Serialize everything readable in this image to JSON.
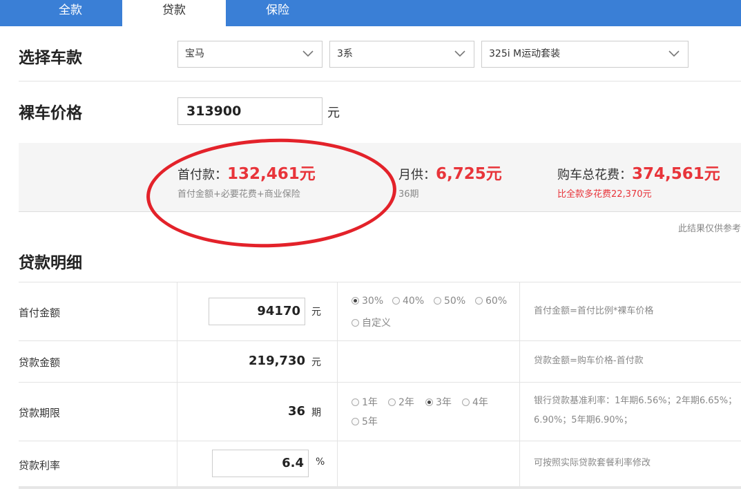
{
  "tabs": [
    {
      "label": "全款",
      "active": false
    },
    {
      "label": "贷款",
      "active": true
    },
    {
      "label": "保险",
      "active": false
    }
  ],
  "car_select": {
    "label": "选择车款",
    "brand": "宝马",
    "series": "3系",
    "model": "325i M运动套装"
  },
  "price": {
    "label": "裸车价格",
    "value": "313900",
    "unit": "元"
  },
  "summary": {
    "down_payment_label": "首付款：",
    "down_payment_value": "132,461元",
    "down_payment_note": "首付金额+必要花费+商业保险",
    "monthly_label": "月供：",
    "monthly_value": "6,725元",
    "monthly_note": "36期",
    "total_label": "购车总花费：",
    "total_value": "374,561元",
    "total_note": "比全款多花费22,370元"
  },
  "disclaimer": "此结果仅供参考",
  "loan_detail": {
    "title": "贷款明细",
    "rows": {
      "down": {
        "label": "首付金额",
        "value": "94170",
        "unit": "元",
        "options": [
          "30%",
          "40%",
          "50%",
          "60%",
          "自定义"
        ],
        "selected": "30%",
        "hint": "首付金额=首付比例*裸车价格"
      },
      "amount": {
        "label": "贷款金额",
        "value": "219,730",
        "unit": "元",
        "hint": "贷款金额=购车价格-首付款"
      },
      "term": {
        "label": "贷款期限",
        "value": "36",
        "unit": "期",
        "options": [
          "1年",
          "2年",
          "3年",
          "4年",
          "5年"
        ],
        "selected": "3年",
        "hint_line1": "银行贷款基准利率：1年期6.56%；2年期6.65%；",
        "hint_line2": "6.90%；5年期6.90%；"
      },
      "rate": {
        "label": "贷款利率",
        "value": "6.4",
        "unit": "%",
        "hint": "可按照实际贷款套餐利率修改"
      }
    }
  },
  "colors": {
    "tab_bar": "#3a7fd6",
    "highlight_red": "#e8343a",
    "annotation_red": "#e3222a"
  }
}
